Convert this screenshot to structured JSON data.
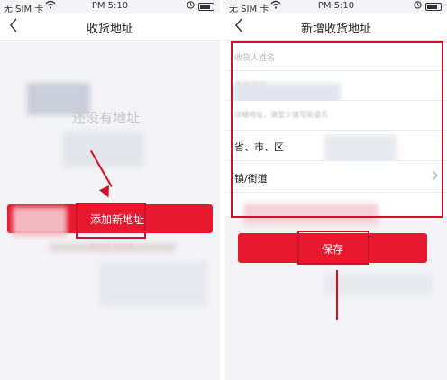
{
  "status_bar": {
    "carrier": "无 SIM 卡",
    "time": "PM 5:10",
    "wifi_icon": "wifi-icon",
    "lock_icon": "lock-icon"
  },
  "left_screen": {
    "nav_title": "收货地址",
    "back_icon": "back-chevron-icon",
    "empty_text": "还没有地址",
    "add_button_label": "添加新地址",
    "blurred_hint": "~~~ ~~~"
  },
  "right_screen": {
    "nav_title": "新增收货地址",
    "back_icon": "back-chevron-icon",
    "recipient_placeholder": "收货人姓名",
    "phone_placeholder": "手机号码",
    "address_placeholder": "详细地址，请至少填写街道名",
    "region_label": "省、市、区",
    "street_label": "镇/街道",
    "save_button_label": "保存"
  },
  "colors": {
    "accent": "#e8182f",
    "highlight": "#d0102a"
  }
}
